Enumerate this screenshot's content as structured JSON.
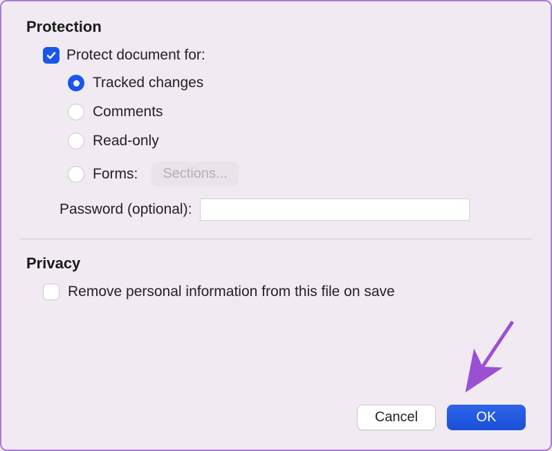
{
  "protection": {
    "title": "Protection",
    "protect_label": "Protect document for:",
    "protect_checked": true,
    "options": {
      "tracked": "Tracked changes",
      "comments": "Comments",
      "readonly": "Read-only",
      "forms": "Forms:",
      "sections_button": "Sections..."
    },
    "password_label": "Password (optional):"
  },
  "privacy": {
    "title": "Privacy",
    "remove_info_label": "Remove personal information from this file on save",
    "remove_info_checked": false
  },
  "buttons": {
    "cancel": "Cancel",
    "ok": "OK"
  },
  "colors": {
    "accent": "#1a56e8",
    "background": "#f1eaf2",
    "border": "#a678e0",
    "arrow": "#9b4fd4"
  }
}
